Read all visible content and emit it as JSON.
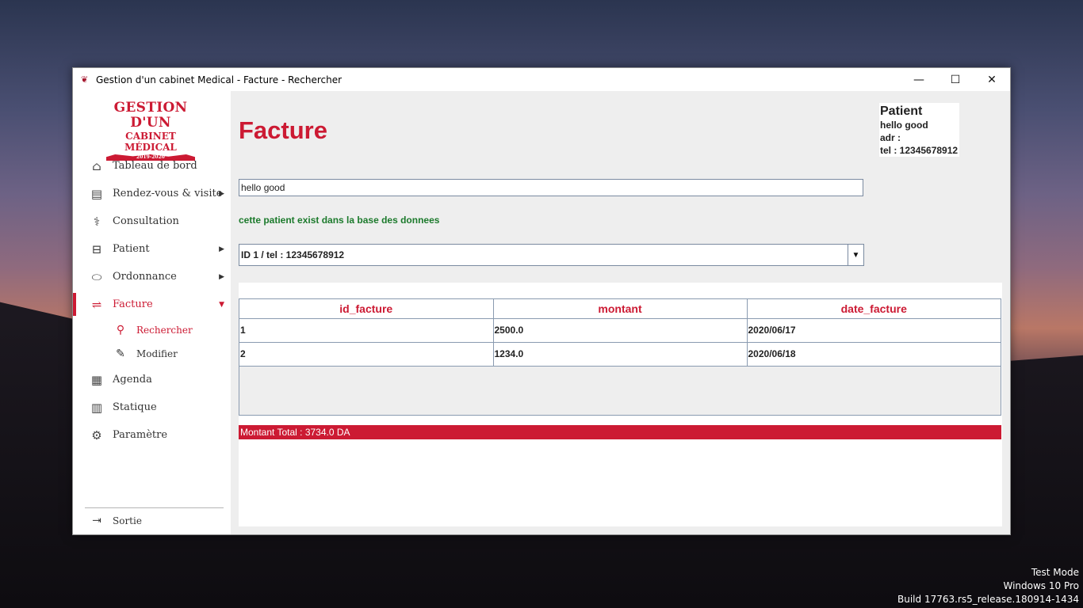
{
  "window": {
    "title": "Gestion d'un cabinet Medical - Facture - Rechercher",
    "minimize": "—",
    "maximize": "☐",
    "close": "✕"
  },
  "logo": {
    "line1": "GESTION D'UN",
    "line2": "CABINET MÉDICAL",
    "line3": "2019-2020"
  },
  "sidebar": {
    "items": [
      {
        "label": "Tableau de bord",
        "icon": "home-icon"
      },
      {
        "label": "Rendez-vous & visite",
        "icon": "document-icon"
      },
      {
        "label": "Consultation",
        "icon": "stethoscope-icon"
      },
      {
        "label": "Patient",
        "icon": "bed-icon"
      },
      {
        "label": "Ordonnance",
        "icon": "pill-icon"
      },
      {
        "label": "Facture",
        "icon": "money-icon"
      },
      {
        "label": "Agenda",
        "icon": "calendar-icon"
      },
      {
        "label": "Statique",
        "icon": "bar-chart-icon"
      },
      {
        "label": "Paramètre",
        "icon": "gear-icon"
      }
    ],
    "facture_sub": [
      {
        "label": "Rechercher",
        "icon": "search-icon"
      },
      {
        "label": "Modifier",
        "icon": "pencil-icon"
      }
    ],
    "sortie": "Sortie"
  },
  "main": {
    "title": "Facture",
    "patient_card": {
      "title": "Patient",
      "name": "hello good",
      "adr": "adr :",
      "tel": "tel : 12345678912"
    },
    "search_value": "hello good",
    "message": "cette patient exist dans la base des donnees",
    "select_value": "ID 1 / tel : 12345678912",
    "table": {
      "headers": [
        "id_facture",
        "montant",
        "date_facture"
      ],
      "rows": [
        [
          "1",
          "2500.0",
          "2020/06/17"
        ],
        [
          "2",
          "1234.0",
          "2020/06/18"
        ]
      ]
    },
    "total": "Montant Total : 3734.0 DA"
  },
  "desktop": {
    "watermark_line1": "Test Mode",
    "watermark_line2": "Windows 10 Pro",
    "watermark_line3": "Build 17763.rs5_release.180914-1434"
  },
  "colors": {
    "accent": "#cc1a33",
    "success": "#1c7a2c"
  }
}
